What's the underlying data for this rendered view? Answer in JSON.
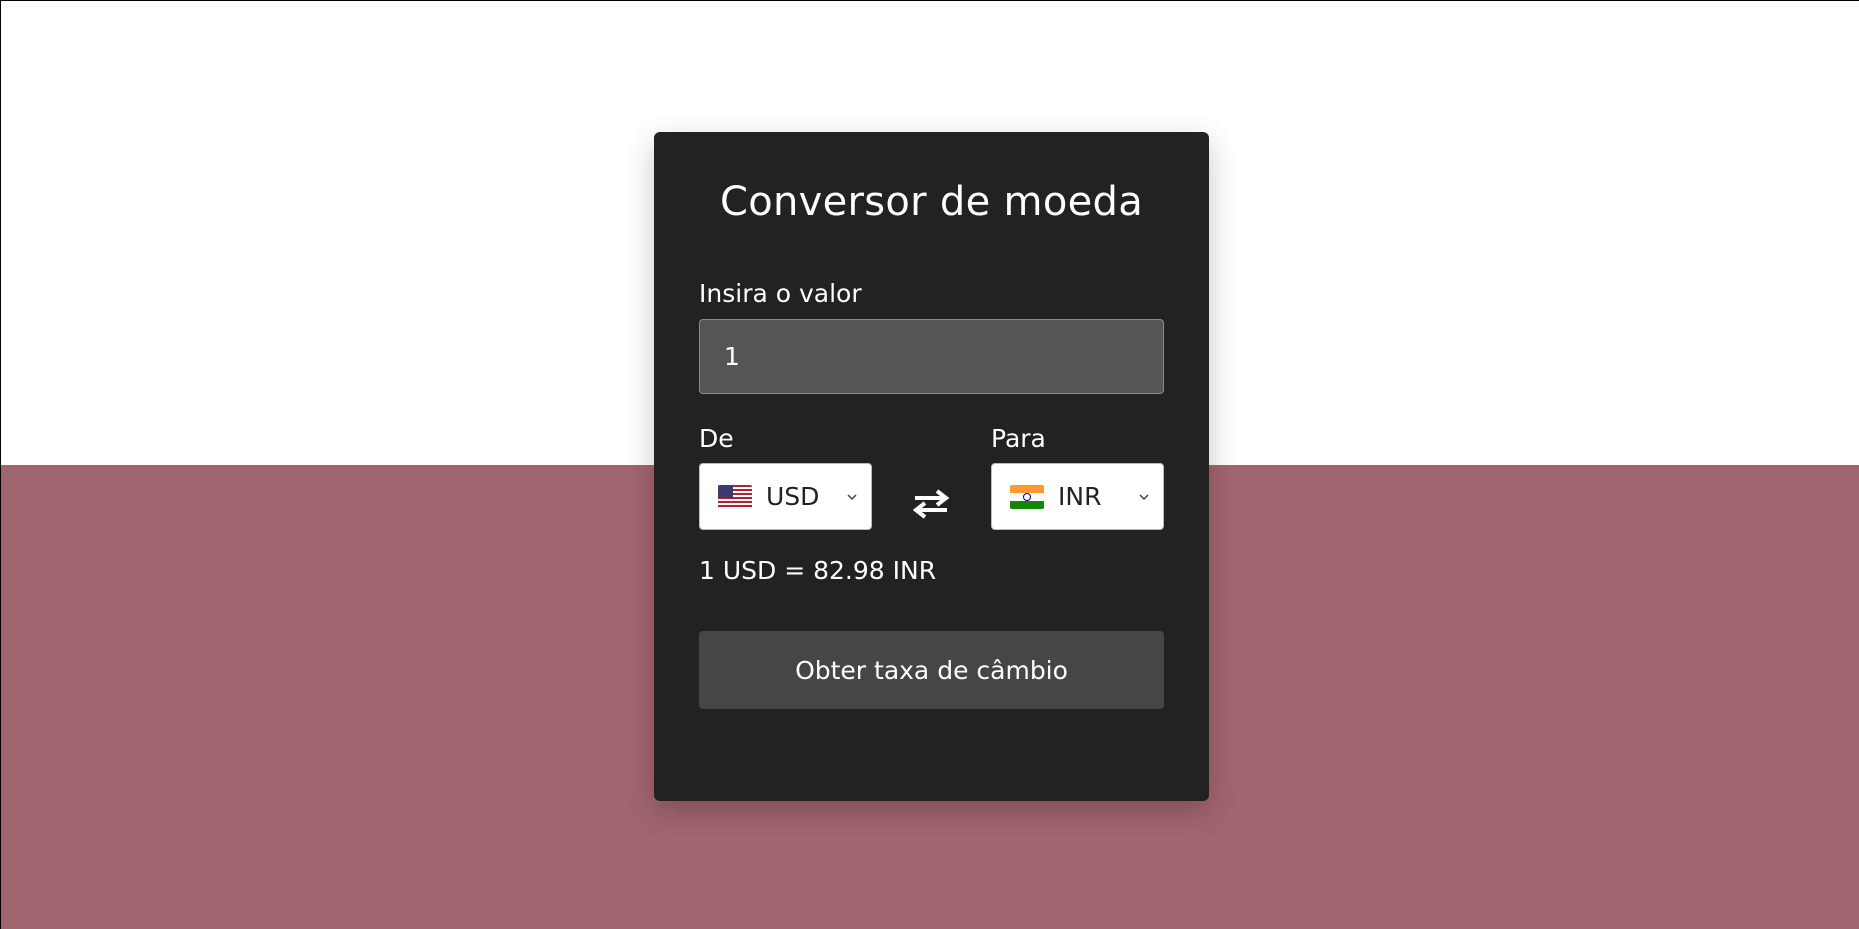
{
  "converter": {
    "title": "Conversor de moeda",
    "amount_label": "Insira o valor",
    "amount_value": "1",
    "from_label": "De",
    "to_label": "Para",
    "from_currency": {
      "code": "USD",
      "flag": "us-flag-icon"
    },
    "to_currency": {
      "code": "INR",
      "flag": "india-flag-icon"
    },
    "swap_icon": "swap-arrows-icon",
    "exchange_result": "1 USD = 82.98 INR",
    "submit_label": "Obter taxa de câmbio"
  },
  "colors": {
    "card_background": "#222222",
    "page_background_top": "#ffffff",
    "page_background_bottom": "#a16570",
    "input_background": "#555555",
    "button_background": "#464646"
  }
}
